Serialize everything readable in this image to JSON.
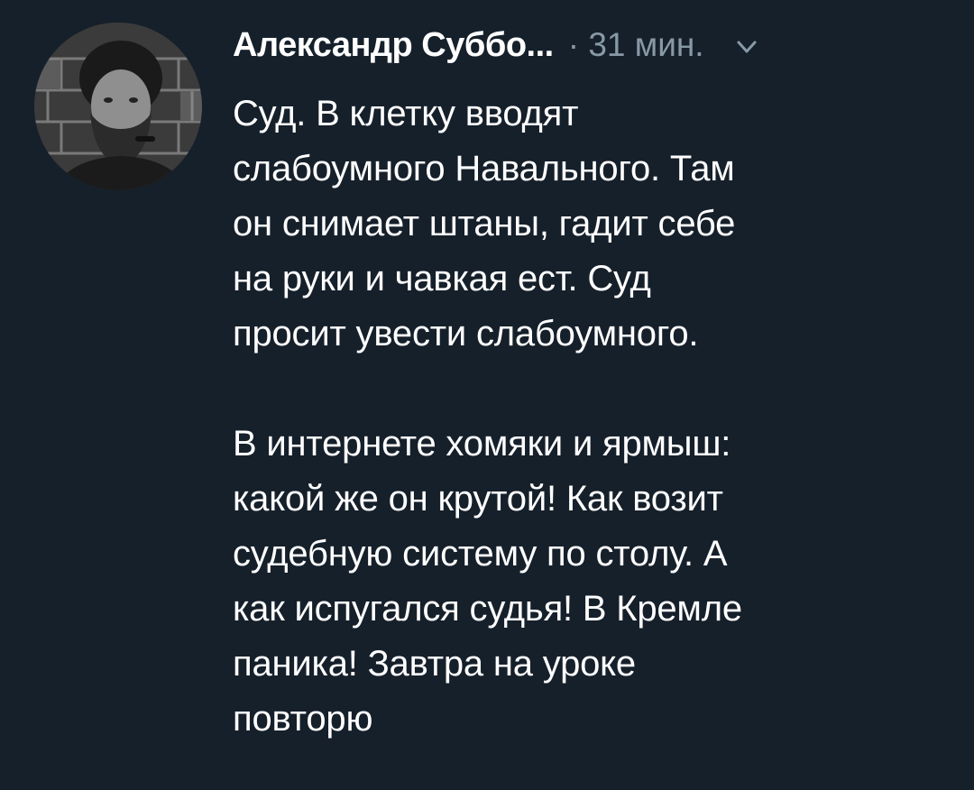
{
  "tweet": {
    "author": "Александр Суббо...",
    "time": "· 31 мин.",
    "menu_icon": "chevron-down-icon",
    "avatar_icon": "user-avatar-photo",
    "paragraphs": [
      {
        "lines": [
          "Суд. В клетку вводят",
          "слабоумного Навального. Там",
          "он снимает штаны, гадит себе",
          "на руки и чавкая ест. Суд",
          "просит увести слабоумного."
        ]
      },
      {
        "lines": [
          "В интернете хомяки и ярмыш:",
          "какой же он крутой! Как возит",
          "судебную систему по столу. А",
          "как испугался судья! В Кремле",
          "паника! Завтра на уроке",
          "повторю"
        ]
      }
    ]
  },
  "colors": {
    "background": "#16202b",
    "text": "#ffffff",
    "meta": "#8899a6"
  }
}
